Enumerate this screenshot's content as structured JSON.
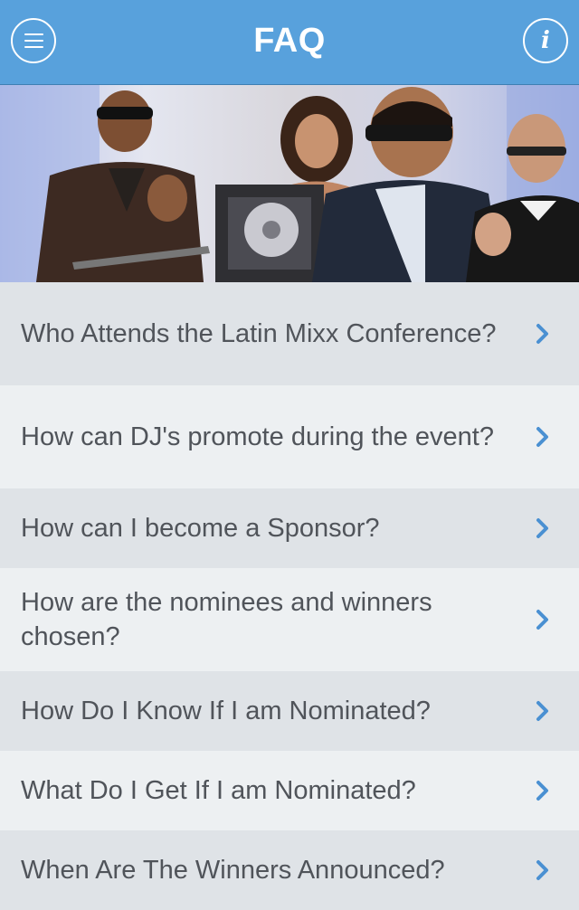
{
  "header": {
    "title": "FAQ",
    "menu_icon": "hamburger-menu-icon",
    "info_icon": "info-icon",
    "info_glyph": "i",
    "bar_color": "#58a1dc"
  },
  "hero": {
    "image": "award-ceremony-photo"
  },
  "faq": {
    "chevron_icon": "chevron-right-icon",
    "chevron_color": "#4a90d2",
    "items": [
      {
        "label": "Who Attends the Latin Mixx Conference?"
      },
      {
        "label": "How can DJ's promote during the event?"
      },
      {
        "label": "How can I become a Sponsor?"
      },
      {
        "label": "How are the nominees and winners chosen?"
      },
      {
        "label": "How Do I Know If I am Nominated?"
      },
      {
        "label": "What Do I Get If I am Nominated?"
      },
      {
        "label": "When Are The Winners Announced?"
      }
    ]
  }
}
